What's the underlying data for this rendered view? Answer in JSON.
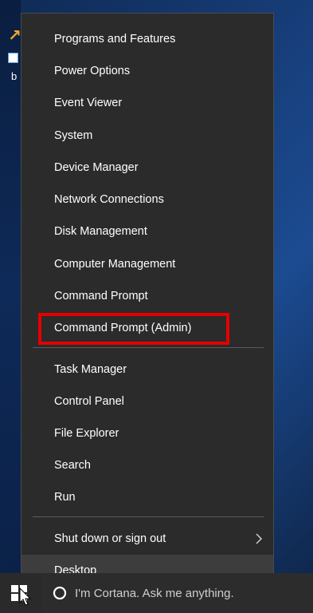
{
  "desktop": {
    "icon_label": "b"
  },
  "menu": {
    "group1": [
      "Programs and Features",
      "Power Options",
      "Event Viewer",
      "System",
      "Device Manager",
      "Network Connections",
      "Disk Management",
      "Computer Management",
      "Command Prompt",
      "Command Prompt (Admin)"
    ],
    "group2": [
      "Task Manager",
      "Control Panel",
      "File Explorer",
      "Search",
      "Run"
    ],
    "shutdown_label": "Shut down or sign out",
    "desktop_label": "Desktop"
  },
  "taskbar": {
    "cortana_text": "I'm Cortana. Ask me anything."
  },
  "colors": {
    "menu_bg": "#2b2b2b",
    "highlight_box": "#e50000",
    "taskbar_bg": "#1a1a1a"
  }
}
